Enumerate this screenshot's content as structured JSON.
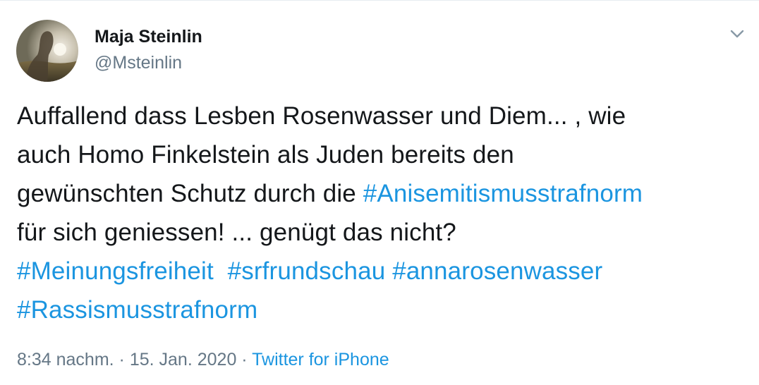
{
  "author": {
    "name": "Maja Steinlin",
    "handle": "@Msteinlin"
  },
  "tweet": {
    "line1": "Auffallend dass Lesben Rosenwasser und Diem... , wie",
    "line2": "auch Homo Finkelstein als Juden bereits den",
    "line3_text": "gewünschten Schutz durch die ",
    "line3_hashtag": "#Anisemitismusstrafnorm",
    "line4": "für sich geniessen! ... genügt das nicht?",
    "hashtags_line5": [
      "#Meinungsfreiheit",
      "#srfrundschau",
      "#annarosenwasser"
    ],
    "hashtag_line6": "#Rassismusstrafnorm"
  },
  "meta": {
    "time": "8:34 nachm.",
    "separator": "·",
    "date": "15. Jan. 2020",
    "source": "Twitter for iPhone"
  },
  "icons": {
    "caret": "chevron-down-icon",
    "avatar": "profile-photo"
  },
  "colors": {
    "link": "#1b95e0",
    "text": "#14171a",
    "secondary": "#657786"
  }
}
